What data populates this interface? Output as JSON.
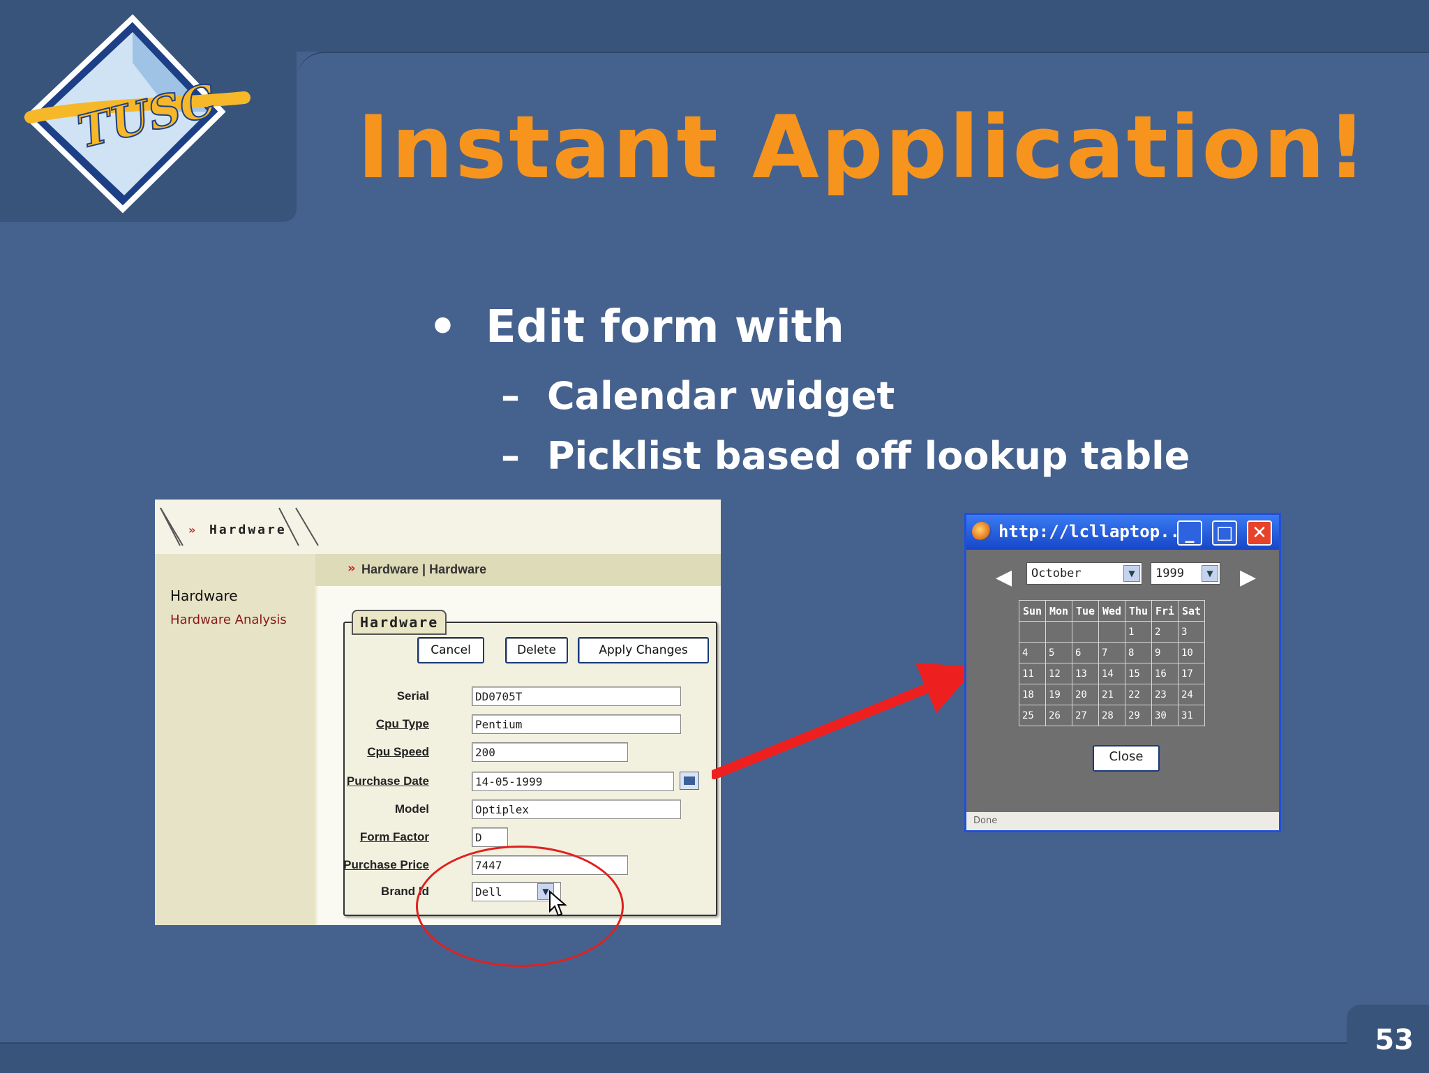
{
  "slide": {
    "title": "Instant Application!",
    "logo_text": "TUSC",
    "bullets": {
      "main": "Edit form with",
      "sub": [
        "Calendar widget",
        "Picklist based off lookup table"
      ],
      "bullet_glyph": "•",
      "dash_glyph": "–"
    },
    "page_number": "53",
    "colors": {
      "background": "#45628f",
      "title": "#f7941d",
      "text": "#ffffff",
      "highlight": "#e0211f"
    }
  },
  "form_shot": {
    "tab_label": "Hardware",
    "breadcrumb": "Hardware | Hardware",
    "side_heading": "Hardware",
    "side_link": "Hardware Analysis",
    "region_title": "Hardware",
    "buttons": [
      "Cancel",
      "Delete",
      "Apply Changes"
    ],
    "fields": [
      {
        "label": "Serial",
        "value": "DD0705T"
      },
      {
        "label": "Cpu Type",
        "value": "Pentium"
      },
      {
        "label": "Cpu Speed",
        "value": "200"
      },
      {
        "label": "Purchase Date",
        "value": "14-05-1999"
      },
      {
        "label": "Model",
        "value": "Optiplex"
      },
      {
        "label": "Form Factor",
        "value": "D"
      },
      {
        "label": "Purchase Price",
        "value": "7447"
      },
      {
        "label": "Brand Id",
        "value": "Dell"
      }
    ]
  },
  "calendar_shot": {
    "window_title": "http://lcllaptop....",
    "month": "October",
    "year": "1999",
    "day_headers": [
      "Sun",
      "Mon",
      "Tue",
      "Wed",
      "Thu",
      "Fri",
      "Sat"
    ],
    "weeks": [
      [
        "",
        "",
        "",
        "",
        "1",
        "2",
        "3"
      ],
      [
        "4",
        "5",
        "6",
        "7",
        "8",
        "9",
        "10"
      ],
      [
        "11",
        "12",
        "13",
        "14",
        "15",
        "16",
        "17"
      ],
      [
        "18",
        "19",
        "20",
        "21",
        "22",
        "23",
        "24"
      ],
      [
        "25",
        "26",
        "27",
        "28",
        "29",
        "30",
        "31"
      ]
    ],
    "close_label": "Close",
    "status_text": "Done"
  }
}
